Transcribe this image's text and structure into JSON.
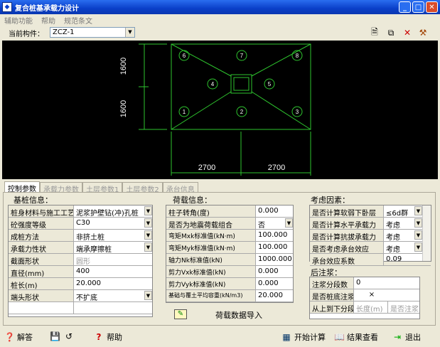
{
  "window": {
    "title": "复合桩基承载力设计"
  },
  "menu": [
    "辅助功能",
    "帮助",
    "规范条文"
  ],
  "toolbar": {
    "component_label": "当前构件：",
    "component_value": "ZCZ-1"
  },
  "drawing": {
    "dim_vertical": [
      "1600",
      "1600"
    ],
    "dim_horizontal": [
      "2700",
      "2700"
    ],
    "pile_labels": [
      "6",
      "7",
      "8",
      "4",
      "5",
      "1",
      "2",
      "3"
    ]
  },
  "tabs": [
    "控制参数",
    "承载力参数",
    "土层参数1",
    "土层参数2",
    "承台信息"
  ],
  "pile_info": {
    "title": "基桩信息：",
    "rows": [
      {
        "key": "桩身材料与施工工艺",
        "value": "泥浆护壁钻(冲)孔桩"
      },
      {
        "key": "砼强度等级",
        "value": "C30"
      },
      {
        "key": "成桩方法",
        "value": "非挤土桩"
      },
      {
        "key": "承载力性状",
        "value": "端承摩擦桩"
      },
      {
        "key": "截面形状",
        "value": "圆形"
      },
      {
        "key": "直径(mm)",
        "value": "400"
      },
      {
        "key": "桩长(m)",
        "value": "20.000"
      },
      {
        "key": "端头形状",
        "value": "不扩底"
      }
    ]
  },
  "load_info": {
    "title": "荷载信息：",
    "rows": [
      {
        "key": "柱子转角(度)",
        "value": "0.000"
      },
      {
        "key": "是否为地震荷载组合",
        "value": "否"
      },
      {
        "key": "弯矩Mxk标准值(kN·m)",
        "value": "100.000"
      },
      {
        "key": "弯矩Myk标准值(kN·m)",
        "value": "100.000"
      },
      {
        "key": "轴力Nk标准值(kN)",
        "value": "1000.000"
      },
      {
        "key": "剪力Vxk标准值(kN)",
        "value": "0.000"
      },
      {
        "key": "剪力Vyk标准值(kN)",
        "value": "0.000"
      },
      {
        "key": "基础与覆土平均容重(kN/m3)",
        "value": "20.000"
      }
    ],
    "import_label": "荷载数据导入"
  },
  "factors": {
    "title": "考虑因素：",
    "rows": [
      {
        "key": "是否计算软弱下卧层",
        "value": "≤6d群"
      },
      {
        "key": "是否计算水平承载力",
        "value": "考虑"
      },
      {
        "key": "是否计算抗拔承载力",
        "value": "考虑"
      },
      {
        "key": "是否考虑承台效应",
        "value": "考虑"
      },
      {
        "key": "承台效应系数",
        "value": "0.09"
      }
    ]
  },
  "post_grout": {
    "title": "后注浆：",
    "rows": [
      {
        "key": "注浆分段数",
        "value": "0"
      },
      {
        "key": "是否桩底注浆",
        "value": "×"
      }
    ],
    "table_header": [
      "从上到下分段",
      "长度(m)",
      "是否注浆"
    ]
  },
  "bottom": {
    "help_answer": "解答",
    "help": "帮助",
    "start": "开始计算",
    "results": "结果查看",
    "exit": "退出"
  }
}
